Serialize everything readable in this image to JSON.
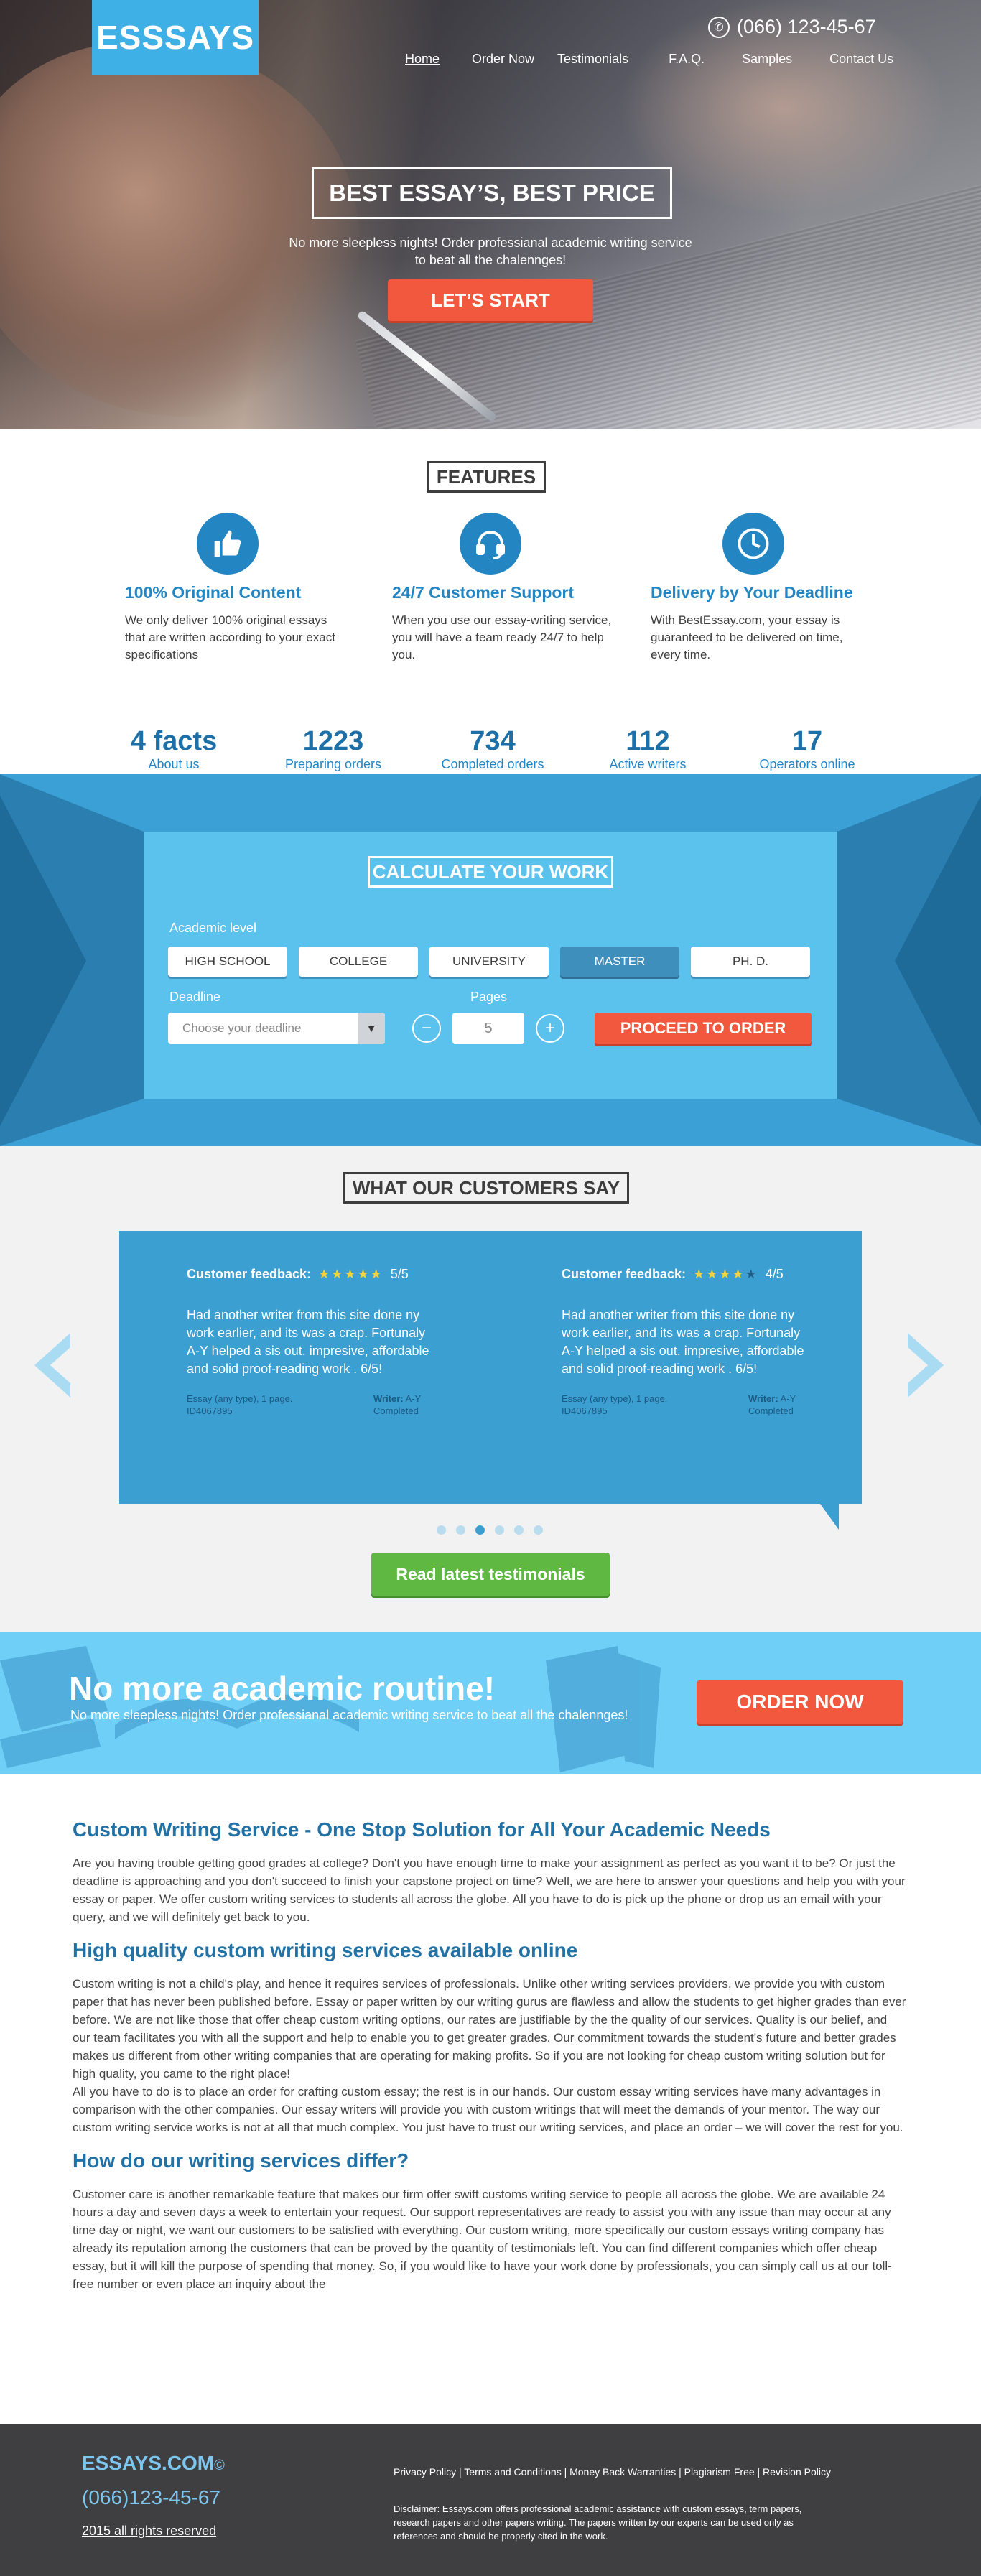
{
  "header": {
    "logo": "ESSSAYS",
    "phone": "(066) 123-45-67",
    "nav": [
      "Home",
      "Order Now",
      "Testimonials",
      "F.A.Q.",
      "Samples",
      "Contact Us"
    ]
  },
  "hero": {
    "title": "BEST ESSAY’S, BEST PRICE",
    "subtitle_line1": "No more sleepless nights! Order professianal academic writing service",
    "subtitle_line2": "to beat all the chalennges!",
    "cta": "LET’S START"
  },
  "features": {
    "heading": "FEATURES",
    "items": [
      {
        "icon": "thumbs-up-icon",
        "title": "100% Original Content",
        "text": "We only deliver 100% original essays that are written according to your exact specifications"
      },
      {
        "icon": "headset-icon",
        "title": "24/7 Customer Support",
        "text": "When you use our essay-writing service, you will have a team ready 24/7 to help you."
      },
      {
        "icon": "clock-icon",
        "title": "Delivery by Your Deadline",
        "text": "With BestEssay.com, your essay is guaranteed to be delivered on time, every time."
      }
    ],
    "facts": [
      {
        "value": "4 facts",
        "label": "About us"
      },
      {
        "value": "1223",
        "label": "Preparing orders"
      },
      {
        "value": "734",
        "label": "Completed orders"
      },
      {
        "value": "112",
        "label": "Active writers"
      },
      {
        "value": "17",
        "label": "Operators online"
      }
    ]
  },
  "calculator": {
    "heading": "CALCULATE YOUR WORK",
    "level_label": "Academic level",
    "levels": [
      "HIGH SCHOOL",
      "COLLEGE",
      "UNIVERSITY",
      "MASTER",
      "PH. D."
    ],
    "selected_level": "MASTER",
    "deadline_label": "Deadline",
    "deadline_placeholder": "Choose your deadline",
    "pages_label": "Pages",
    "pages_value": "5",
    "minus": "−",
    "plus": "+",
    "proceed": "PROCEED TO ORDER"
  },
  "testimonials": {
    "heading": "WHAT OUR CUSTOMERS SAY",
    "items": [
      {
        "label": "Customer feedback:",
        "stars": "★★★★★",
        "rating": "5/5",
        "text": "Had another writer from this site done ny work earlier, and its was a crap. Fortunaly A-Y helped a sis out. impresive, affordable and solid proof-reading work . 6/5!",
        "meta_left": "Essay (any type), 1 page. ID4067895",
        "meta_right_bold": "Writer:",
        "meta_right": " A-Y Completed"
      },
      {
        "label": "Customer feedback:",
        "stars": "★★★★",
        "star_empty": "★",
        "rating": "4/5",
        "text": "Had another writer from this site done ny work earlier, and its was a crap. Fortunaly A-Y helped a sis out. impresive, affordable and solid proof-reading work . 6/5!",
        "meta_left": "Essay (any type), 1 page. ID4067895",
        "meta_right_bold": "Writer:",
        "meta_right": " A-Y Completed"
      }
    ],
    "active_dot": 2,
    "read_button": "Read latest testimonials"
  },
  "banner": {
    "title": "No more academic routine!",
    "subtitle": "No more sleepless nights! Order professianal academic writing service to beat all the chalennges!",
    "button": "ORDER NOW"
  },
  "content": {
    "h1": "Custom Writing Service - One Stop Solution for All Your Academic Needs",
    "p1": "Are you having trouble getting good grades at college? Don't you have enough time to make your assignment as perfect as you want it to be? Or just the deadline is approaching and you don't succeed to finish your capstone project on time? Well, we are here to answer your questions and help you with your essay or paper. We offer custom writing services to students all across the globe. All you have to do is pick up the phone or drop us an email with your query, and we will definitely get back to you.",
    "h2": "High quality custom writing services available online",
    "p2": "Custom writing is not a child's play, and hence it requires services of professionals. Unlike other writing services providers, we provide you with custom paper that has never been published before. Essay or paper written by our writing gurus are flawless and allow the students to get higher grades than ever before. We are not like those that offer cheap custom writing options, our rates are justifiable by the the quality of our services. Quality is our belief, and our team facilitates you with all the support and help to enable you to get greater grades. Our commitment towards the student's future and better grades makes us different from other writing companies that are operating for making profits. So if you are not looking for cheap custom writing solution but for high quality, you came to the right place!",
    "p3": "All you have to do is to place an order for crafting custom essay; the rest is in our hands. Our custom essay writing services have many advantages in comparison with the other companies. Our essay writers will provide you with custom writings that will meet the demands of your mentor. The way our custom writing service works is not at all that much complex. You just have to trust our writing services, and place an order – we will cover the rest for you.",
    "h3": "How do our writing services differ?",
    "p4": "Customer care is another remarkable feature that makes our firm offer swift customs writing service to people all across the globe. We are available 24 hours a day and seven days a week to entertain your request. Our support representatives are ready to assist you with any issue than may occur at any time day or night, we want our customers to be satisfied with everything. Our custom writing, more specifically our custom essays writing company has already its reputation among the customers that can be proved by the quantity of testimonials left. You can find different companies which offer cheap essay, but it will kill the purpose of spending that money. So, if you would like to have your work done by professionals, you can simply call us at our toll-free number or even place an inquiry about the"
  },
  "footer": {
    "brand": "ESSAYS.COM",
    "copyright_mark": "©",
    "phone": "(066)123-45-67",
    "rights": "2015 all rights reserved",
    "links": "Privacy Policy | Terms and Conditions | Money Back Warranties | Plagiarism Free | Revision Policy",
    "disclaimer": "Disclaimer: Essays.com offers professional academic assistance with custom essays, term papers, research papers and other papers writing. The papers written by our experts can be used only as references and should be properly cited in the work."
  },
  "colors": {
    "brand_blue": "#3fb0e6",
    "accent_orange": "#f2583e",
    "heading_blue": "#2386c3",
    "green": "#5fb842",
    "footer_dark": "#3f3f41"
  }
}
